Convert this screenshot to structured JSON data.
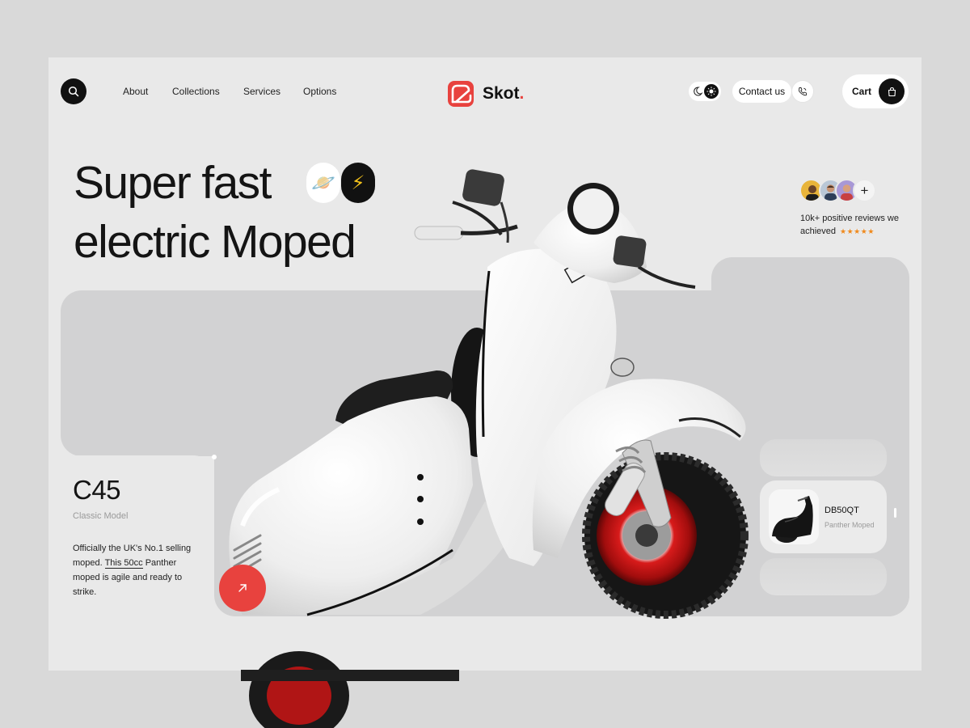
{
  "nav": {
    "links": [
      "About",
      "Collections",
      "Services",
      "Options"
    ]
  },
  "brand": {
    "name": "Skot",
    "dot": ".",
    "accent_color": "#e8423e"
  },
  "header_actions": {
    "contact_label": "Contact us",
    "cart_label": "Cart",
    "icons": [
      "search-icon",
      "moon-icon",
      "sun-icon",
      "phone-icon",
      "shopping-bag-icon"
    ]
  },
  "hero": {
    "title_line1": "Super fast",
    "title_line2": "electric Moped",
    "badge_planet": "🪐",
    "badge_bolt": "⚡"
  },
  "reviews": {
    "text": "10k+ positive reviews we achieved",
    "stars": "★★★★★",
    "plus": "+"
  },
  "model": {
    "name": "C45",
    "subtitle": "Classic Model",
    "desc_part1": "Officially the UK's No.1 selling moped.",
    "desc_link": "This 50cc",
    "desc_part2": "Panther moped is agile and ready to strike."
  },
  "product_card": {
    "name": "DB50QT",
    "subtitle": "Panther Moped"
  },
  "colors": {
    "page_bg": "#d9d9d9",
    "frame_bg": "#e9e9e9",
    "panel_bg": "#d2d2d3",
    "dark": "#111111",
    "star": "#f08a1d"
  }
}
